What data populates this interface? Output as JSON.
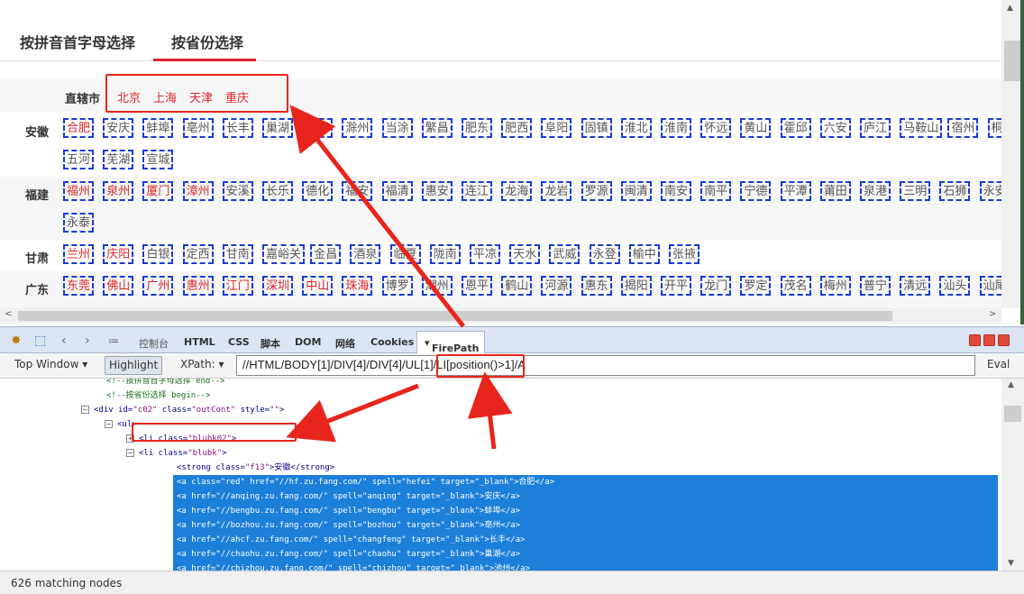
{
  "tabs": {
    "pinyin": "按拼音首字母选择",
    "province": "按省份选择"
  },
  "direct_cities": {
    "label": "直辖市",
    "cities": [
      "北京",
      "上海",
      "天津",
      "重庆"
    ]
  },
  "provinces": [
    {
      "name": "安徽",
      "lines": [
        [
          {
            "n": "合肥",
            "red": true
          },
          {
            "n": "安庆"
          },
          {
            "n": "蚌埠"
          },
          {
            "n": "亳州"
          },
          {
            "n": "长丰"
          },
          {
            "n": "巢湖"
          },
          {
            "n": "池州"
          },
          {
            "n": "滁州"
          },
          {
            "n": "当涂"
          },
          {
            "n": "繁昌"
          },
          {
            "n": "肥东"
          },
          {
            "n": "肥西"
          },
          {
            "n": "阜阳"
          },
          {
            "n": "固镇"
          },
          {
            "n": "淮北"
          },
          {
            "n": "淮南"
          },
          {
            "n": "怀远"
          },
          {
            "n": "黄山"
          },
          {
            "n": "霍邱"
          },
          {
            "n": "六安"
          },
          {
            "n": "庐江"
          },
          {
            "n": "马鞍山"
          },
          {
            "n": "宿州"
          },
          {
            "n": "桐城"
          }
        ],
        [
          {
            "n": "五河"
          },
          {
            "n": "芜湖"
          },
          {
            "n": "宣城"
          }
        ]
      ]
    },
    {
      "name": "福建",
      "lines": [
        [
          {
            "n": "福州",
            "red": true
          },
          {
            "n": "泉州",
            "red": true
          },
          {
            "n": "厦门",
            "red": true
          },
          {
            "n": "漳州",
            "red": true
          },
          {
            "n": "安溪"
          },
          {
            "n": "长乐"
          },
          {
            "n": "德化"
          },
          {
            "n": "福安"
          },
          {
            "n": "福清"
          },
          {
            "n": "惠安"
          },
          {
            "n": "连江"
          },
          {
            "n": "龙海"
          },
          {
            "n": "龙岩"
          },
          {
            "n": "罗源"
          },
          {
            "n": "闽清"
          },
          {
            "n": "南安"
          },
          {
            "n": "南平"
          },
          {
            "n": "宁德"
          },
          {
            "n": "平潭"
          },
          {
            "n": "莆田"
          },
          {
            "n": "泉港"
          },
          {
            "n": "三明"
          },
          {
            "n": "石狮"
          },
          {
            "n": "永安"
          }
        ],
        [
          {
            "n": "永泰"
          }
        ]
      ]
    },
    {
      "name": "甘肃",
      "lines": [
        [
          {
            "n": "兰州",
            "red": true
          },
          {
            "n": "庆阳",
            "red": true
          },
          {
            "n": "白银"
          },
          {
            "n": "定西"
          },
          {
            "n": "甘南"
          },
          {
            "n": "嘉峪关"
          },
          {
            "n": "金昌"
          },
          {
            "n": "酒泉"
          },
          {
            "n": "临夏"
          },
          {
            "n": "陇南"
          },
          {
            "n": "平凉"
          },
          {
            "n": "天水"
          },
          {
            "n": "武威"
          },
          {
            "n": "永登"
          },
          {
            "n": "榆中"
          },
          {
            "n": "张掖"
          }
        ]
      ]
    },
    {
      "name": "广东",
      "lines": [
        [
          {
            "n": "东莞",
            "red": true
          },
          {
            "n": "佛山",
            "red": true
          },
          {
            "n": "广州",
            "red": true
          },
          {
            "n": "惠州",
            "red": true
          },
          {
            "n": "江门",
            "red": true
          },
          {
            "n": "深圳",
            "red": true
          },
          {
            "n": "中山",
            "red": true
          },
          {
            "n": "珠海",
            "red": true
          },
          {
            "n": "博罗"
          },
          {
            "n": "潮州"
          },
          {
            "n": "恩平"
          },
          {
            "n": "鹤山"
          },
          {
            "n": "河源"
          },
          {
            "n": "惠东"
          },
          {
            "n": "揭阳"
          },
          {
            "n": "开平"
          },
          {
            "n": "龙门"
          },
          {
            "n": "罗定"
          },
          {
            "n": "茂名"
          },
          {
            "n": "梅州"
          },
          {
            "n": "普宁"
          },
          {
            "n": "清远"
          },
          {
            "n": "汕头"
          },
          {
            "n": "汕尾"
          }
        ]
      ]
    }
  ],
  "firebug": {
    "tabs": [
      "控制台",
      "HTML",
      "CSS",
      "脚本",
      "DOM",
      "网络",
      "Cookies"
    ],
    "active_tab": "FirePath",
    "top_window": "Top Window",
    "highlight": "Highlight",
    "xpath_label": "XPath:",
    "xpath_value": "//HTML/BODY[1]/DIV[4]/DIV[4]/UL[1]/LI[position()>1]/A",
    "eval": "Eval",
    "status": "626 matching nodes"
  },
  "source_lines": [
    {
      "indent": 118,
      "type": "comment",
      "text": "<!--按拼音首字母选择 end-->"
    },
    {
      "indent": 118,
      "type": "comment",
      "text": "<!--按省份选择 begin-->"
    },
    {
      "indent": 106,
      "type": "tag",
      "twisty": "−",
      "text": "<div  id=\"c02\"  class=\"outCont\"  style=\"\">"
    },
    {
      "indent": 132,
      "type": "tag",
      "twisty": "−",
      "text": "<ul>"
    },
    {
      "indent": 156,
      "type": "tag",
      "twisty": "+",
      "text": "<li  class=\"blubk02\">"
    },
    {
      "indent": 156,
      "type": "tag",
      "twisty": "−",
      "text": "<li  class=\"blubk\">"
    },
    {
      "indent": 196,
      "type": "tag",
      "text": "<strong  class=\"f13\">安徽</strong>"
    },
    {
      "indent": 196,
      "type": "sel",
      "text": "<a  class=\"red\"  href=\"//hf.zu.fang.com/\"  spell=\"hefei\"  target=\"_blank\">合肥</a>"
    },
    {
      "indent": 196,
      "type": "sel",
      "text": "<a  href=\"//anqing.zu.fang.com/\"  spell=\"anqing\"  target=\"_blank\">安庆</a>"
    },
    {
      "indent": 196,
      "type": "sel",
      "text": "<a  href=\"//bengbu.zu.fang.com/\"  spell=\"bengbu\"  target=\"_blank\">蚌埠</a>"
    },
    {
      "indent": 196,
      "type": "sel",
      "text": "<a  href=\"//bozhou.zu.fang.com/\"  spell=\"bozhou\"  target=\"_blank\">亳州</a>"
    },
    {
      "indent": 196,
      "type": "sel",
      "text": "<a  href=\"//ahcf.zu.fang.com/\"  spell=\"changfeng\"  target=\"_blank\">长丰</a>"
    },
    {
      "indent": 196,
      "type": "sel",
      "text": "<a  href=\"//chaohu.zu.fang.com/\"  spell=\"chaohu\"  target=\"_blank\">巢湖</a>"
    },
    {
      "indent": 196,
      "type": "sel",
      "text": "<a  href=\"//chizhou.zu.fang.com/\"  spell=\"chizhou\"  target=\"_blank\">池州</a>"
    }
  ]
}
